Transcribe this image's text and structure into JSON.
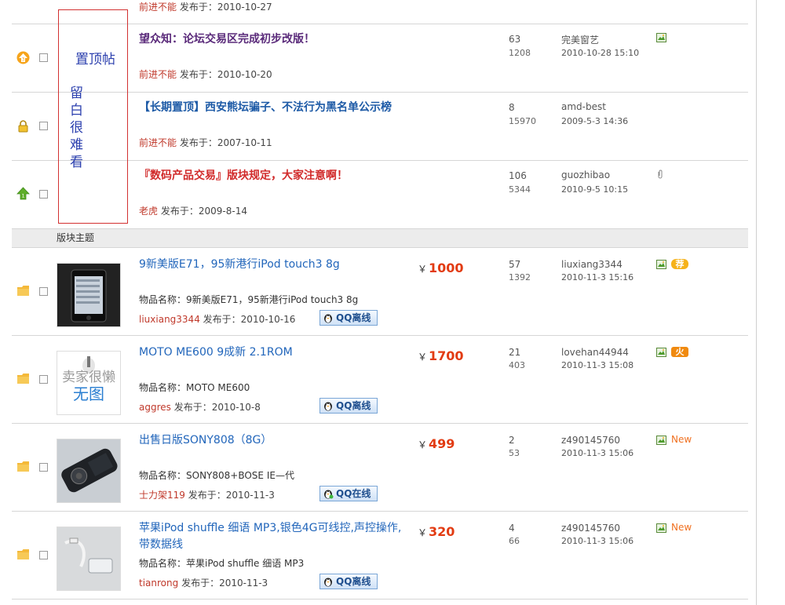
{
  "top_partial": {
    "author": "前进不能",
    "posted_prefix": "发布于：",
    "date": "2010-10-27"
  },
  "annotation": {
    "top_label": "置顶帖",
    "vertical_label": [
      "留",
      "白",
      "很",
      "难",
      "看"
    ]
  },
  "sticky_threads": [
    {
      "title": "望众知：论坛交易区完成初步改版！",
      "title_color": "#5a2a7a",
      "author": "前进不能",
      "posted_prefix": "发布于：",
      "date": "2010-10-20",
      "replies": "63",
      "views": "1208",
      "last_user": "完美窗艺",
      "last_time": "2010-10-28 15:10",
      "icon": "sticky-level-3-icon"
    },
    {
      "title": "【长期置顶】西安熊坛骗子、不法行为黑名单公示榜",
      "title_color": "#1d5aa6",
      "author": "前进不能",
      "posted_prefix": "发布于：",
      "date": "2007-10-11",
      "replies": "8",
      "views": "15970",
      "last_user": "amd-best",
      "last_time": "2009-5-3 14:36",
      "icon": "locked-icon"
    },
    {
      "title": "『数码产品交易』版块规定，大家注意啊！",
      "title_color": "#d12a2a",
      "author": "老虎",
      "posted_prefix": "发布于：",
      "date": "2009-8-14",
      "replies": "106",
      "views": "5344",
      "last_user": "guozhibao",
      "last_time": "2010-9-5 10:15",
      "icon": "sticky-level-1-icon"
    }
  ],
  "section_label": "版块主题",
  "item_name_prefix": "物品名称：",
  "currency": "￥",
  "trade_threads": [
    {
      "title": "9新美版E71，95新港行iPod touch3 8g",
      "price": "1000",
      "item_name": "9新美版E71，95新港行iPod touch3 8g",
      "author": "liuxiang3344",
      "posted_prefix": "发布于：",
      "date": "2010-10-16",
      "qq": "QQ离线",
      "replies": "57",
      "views": "1392",
      "last_user": "liuxiang3344",
      "last_time": "2010-11-3 15:16",
      "badge": "荐"
    },
    {
      "title": "MOTO ME600 9成新 2.1ROM",
      "price": "1700",
      "item_name": "MOTO ME600",
      "author": "aggres",
      "posted_prefix": "发布于：",
      "date": "2010-10-8",
      "qq": "QQ离线",
      "replies": "21",
      "views": "403",
      "last_user": "lovehan44944",
      "last_time": "2010-11-3 15:08",
      "badge": "火",
      "noimg_line1": "卖家很懒",
      "noimg_line2": "无图"
    },
    {
      "title": "出售日版SONY808（8G）",
      "price": "499",
      "item_name": "SONY808+BOSE IE—代",
      "author": "士力架119",
      "posted_prefix": "发布于：",
      "date": "2010-11-3",
      "qq": "QQ在线",
      "replies": "2",
      "views": "53",
      "last_user": "z490145760",
      "last_time": "2010-11-3 15:06",
      "badge": "New"
    },
    {
      "title": "苹果iPod shuffle 细语 MP3,银色4G可线控,声控操作,带数据线",
      "price": "320",
      "item_name": "苹果iPod shuffle 细语 MP3",
      "author": "tianrong",
      "posted_prefix": "发布于：",
      "date": "2010-11-3",
      "qq": "QQ离线",
      "replies": "4",
      "views": "66",
      "last_user": "z490145760",
      "last_time": "2010-11-3 15:06",
      "badge": "New"
    }
  ]
}
